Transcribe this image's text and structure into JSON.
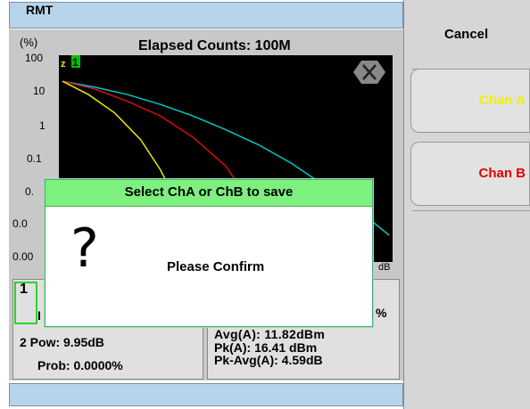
{
  "header": {
    "title": "RMT"
  },
  "chart": {
    "title": "Elapsed Counts:  100M",
    "y_unit": "(%)",
    "y_ticks": [
      "100",
      "10",
      "1",
      "0.1",
      "0.",
      "0.0",
      "0.00"
    ],
    "x_tick_right": "dB",
    "channel_marker": "1",
    "close_icon": "close-icon"
  },
  "chart_data": {
    "type": "line",
    "title": "Elapsed Counts:  100M",
    "ylabel": "(%)",
    "yscale": "log",
    "ylim": [
      0.001,
      100
    ],
    "series": [
      {
        "color": "#00c8c8",
        "x": [
          0,
          0.1,
          0.2,
          0.3,
          0.4,
          0.5,
          0.6,
          0.7,
          0.8,
          0.9,
          1.0
        ],
        "y": [
          40,
          28,
          18,
          10,
          5,
          2.2,
          0.9,
          0.3,
          0.08,
          0.02,
          0.004
        ]
      },
      {
        "color": "#d01010",
        "x": [
          0,
          0.1,
          0.2,
          0.3,
          0.4,
          0.5,
          0.55,
          0.6,
          0.65
        ],
        "y": [
          40,
          25,
          12,
          5,
          1.4,
          0.25,
          0.06,
          0.01,
          0.002
        ]
      },
      {
        "color": "#e8e800",
        "x": [
          0,
          0.08,
          0.16,
          0.24,
          0.3,
          0.36,
          0.4
        ],
        "y": [
          40,
          18,
          6,
          1.2,
          0.2,
          0.02,
          0.002
        ]
      }
    ]
  },
  "left_box": {
    "channel_label": "1",
    "line_letter": "I",
    "row1": "2 Pow:  9.95dB",
    "row2": "Prob:  0.0000%"
  },
  "right_box": {
    "row0": "Avg(A):     11.82dBm",
    "row1": "Pk(A):        16.41 dBm",
    "row2": "Pk-Avg(A): 4.59dB",
    "edge_glyph": "%"
  },
  "dialog": {
    "title": "Select ChA or ChB to save",
    "icon": "?",
    "message": "Please Confirm"
  },
  "softkeys": {
    "cancel": "Cancel",
    "chan_a": "Chan A",
    "chan_b": "Chan B",
    "chan_a_color": "#f0f000",
    "chan_b_color": "#e00000"
  }
}
